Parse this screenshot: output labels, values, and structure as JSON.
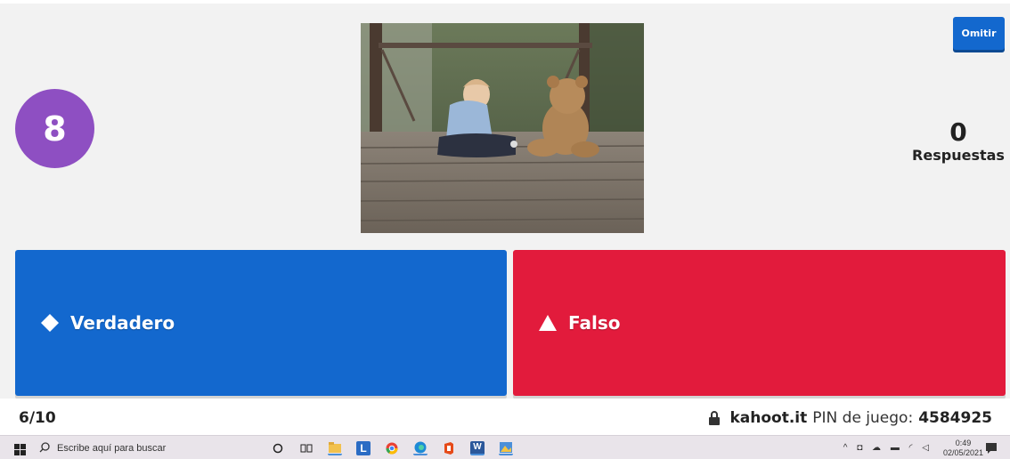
{
  "timer": {
    "value": "8"
  },
  "skip_button": {
    "label": "Omitir"
  },
  "answers_count": {
    "value": "0",
    "label": "Respuestas"
  },
  "answers": [
    {
      "label": "Verdadero",
      "shape": "diamond-icon",
      "color": "#1368ce"
    },
    {
      "label": "Falso",
      "shape": "triangle-icon",
      "color": "#e21b3c"
    }
  ],
  "footer": {
    "question_counter": "6/10",
    "site": "kahoot.it",
    "pin_label": "PIN de juego:",
    "pin_value": "4584925"
  },
  "taskbar": {
    "search_placeholder": "Escribe aquí para buscar",
    "time": "0:49",
    "date": "02/05/2021",
    "notification_count": "1"
  },
  "colors": {
    "timer": "#8e4fc2",
    "accent_blue": "#1368ce",
    "accent_red": "#e21b3c"
  }
}
